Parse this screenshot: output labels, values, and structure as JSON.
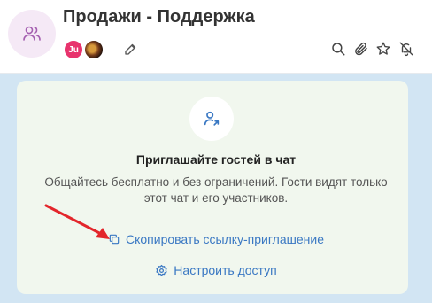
{
  "header": {
    "title": "Продажи - Поддержка",
    "avatar_icon": "users-icon",
    "members": [
      {
        "initials": "Ju",
        "color": "#e8336d"
      },
      {
        "initials": "",
        "kind": "photo"
      }
    ],
    "actions": [
      "search-icon",
      "paperclip-icon",
      "star-icon",
      "bell-off-icon"
    ]
  },
  "invite": {
    "icon": "add-user-icon",
    "title": "Приглашайте гостей в чат",
    "description": "Общайтесь бесплатно и без ограничений. Гости видят только этот чат и его участников.",
    "copy_link_label": "Скопировать ссылку-приглашение",
    "access_label": "Настроить доступ"
  },
  "colors": {
    "accent": "#3a78c3",
    "arrow": "#e3262b",
    "card_bg": "#f1f7ee",
    "chat_bg": "#d2e5f3"
  }
}
